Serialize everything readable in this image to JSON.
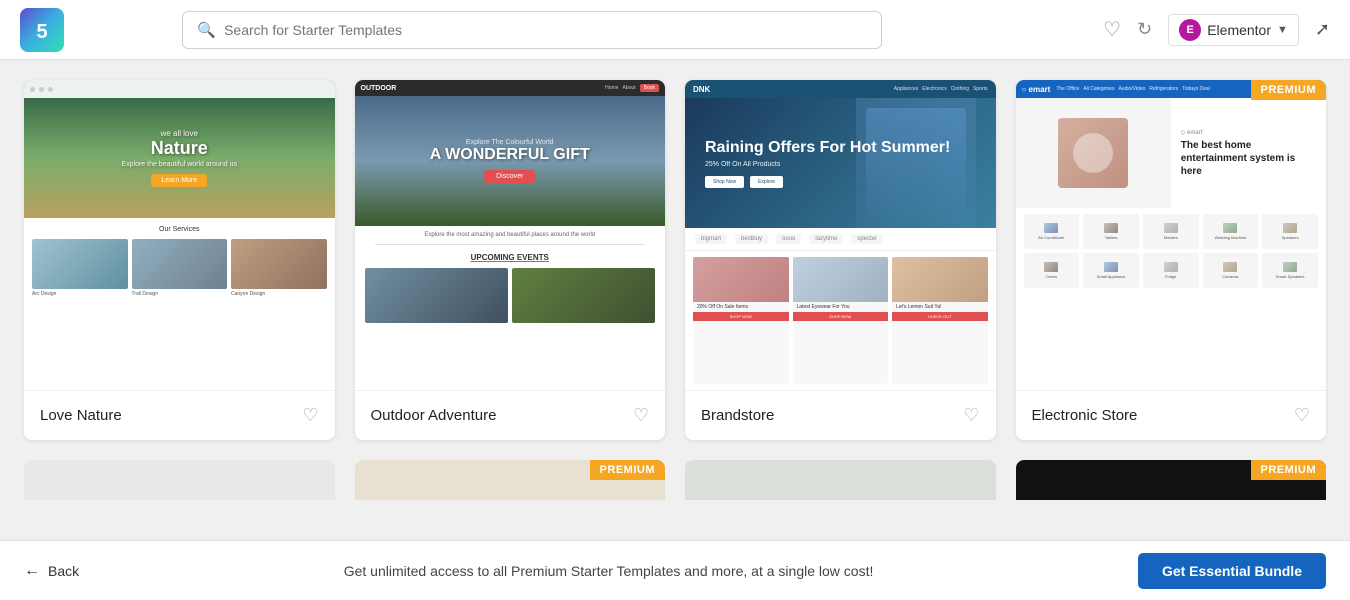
{
  "topbar": {
    "search_placeholder": "Search for Starter Templates",
    "elementor_label": "Elementor",
    "logo_text": "5"
  },
  "templates": [
    {
      "id": "love-nature",
      "name": "Love Nature",
      "premium": false,
      "hero_line1": "we all love",
      "hero_line2": "Nature",
      "services_title": "Our Services",
      "btn_label": "Learn More"
    },
    {
      "id": "outdoor-adventure",
      "name": "Outdoor Adventure",
      "premium": false,
      "header_logo": "OUTDOOR",
      "hero_title": "A WONDERFUL GIFT",
      "events_title": "UPCOMING EVENTS",
      "btn_label": "Discover"
    },
    {
      "id": "brandstore",
      "name": "Brandstore",
      "premium": false,
      "header_logo": "DNK",
      "hero_title": "Raining Offers For Hot Summer!",
      "hero_sub": "25% Off On All Products"
    },
    {
      "id": "electronic-store",
      "name": "Electronic Store",
      "premium": true,
      "premium_label": "PREMIUM",
      "hero_title": "The best home entertainment system is here"
    }
  ],
  "bottombar": {
    "back_label": "Back",
    "promo_text": "Get unlimited access to all Premium Starter Templates and more, at a single low cost!",
    "bundle_btn_label": "Get Essential Bundle"
  },
  "partial_cards": [
    {
      "id": "p1",
      "premium": false
    },
    {
      "id": "p2",
      "premium": true,
      "premium_label": "PREMIUM"
    },
    {
      "id": "p3",
      "premium": false
    },
    {
      "id": "p4",
      "premium": true,
      "premium_label": "PREMIUM"
    }
  ]
}
